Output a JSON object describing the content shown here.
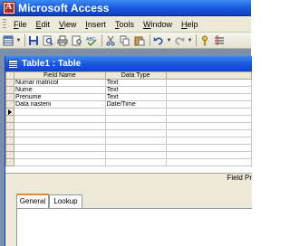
{
  "app": {
    "title": "Microsoft Access"
  },
  "menu": {
    "items": [
      {
        "label": "File",
        "key": "F",
        "rest": "ile"
      },
      {
        "label": "Edit",
        "key": "E",
        "rest": "dit"
      },
      {
        "label": "View",
        "key": "V",
        "rest": "iew"
      },
      {
        "label": "Insert",
        "key": "I",
        "rest": "nsert"
      },
      {
        "label": "Tools",
        "key": "T",
        "rest": "ools"
      },
      {
        "label": "Window",
        "key": "W",
        "rest": "indow"
      },
      {
        "label": "Help",
        "key": "H",
        "rest": "elp"
      }
    ]
  },
  "toolbar": {
    "icons": [
      "view-icon",
      "save-icon",
      "search-icon",
      "print-icon",
      "print-preview-icon",
      "spelling-icon",
      "cut-icon",
      "copy-icon",
      "paste-icon",
      "undo-icon",
      "redo-icon",
      "primary-key-icon",
      "indexes-icon"
    ]
  },
  "document": {
    "title": "Table1 : Table",
    "columns": {
      "field_name": "Field Name",
      "data_type": "Data Type",
      "description": ""
    },
    "rows": [
      {
        "field_name": "Numar matricol",
        "data_type": "Text"
      },
      {
        "field_name": "Nume",
        "data_type": "Text"
      },
      {
        "field_name": "Prenume",
        "data_type": "Text"
      },
      {
        "field_name": "Data nasterii",
        "data_type": "Date/Time"
      },
      {
        "field_name": "",
        "data_type": ""
      },
      {
        "field_name": "",
        "data_type": ""
      },
      {
        "field_name": "",
        "data_type": ""
      },
      {
        "field_name": "",
        "data_type": ""
      },
      {
        "field_name": "",
        "data_type": ""
      },
      {
        "field_name": "",
        "data_type": ""
      },
      {
        "field_name": "",
        "data_type": ""
      },
      {
        "field_name": "",
        "data_type": ""
      }
    ],
    "current_row": 4,
    "field_properties_label": "Field Pr",
    "tabs": [
      "General",
      "Lookup"
    ],
    "active_tab": "General"
  },
  "colors": {
    "titlebar": "#1d5ee0",
    "mdi_background": "#7d8ea8",
    "chrome": "#ece9d8",
    "active_tab_accent": "#e68b2c"
  }
}
